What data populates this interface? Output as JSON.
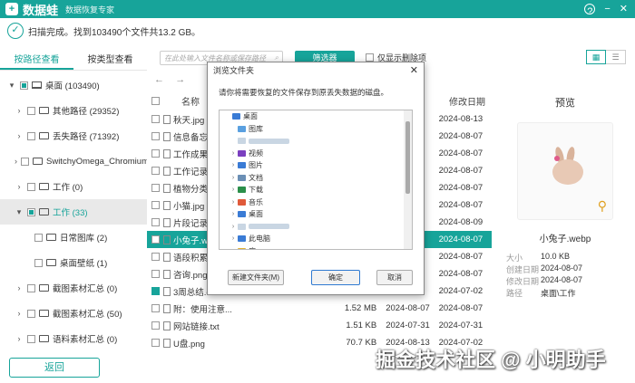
{
  "app": {
    "brand": "数据蛙",
    "subtitle": "数据恢复专家",
    "logo_glyph": "+"
  },
  "window": {
    "help": "?",
    "minimize": "−",
    "close": "✕"
  },
  "status": {
    "text": "扫描完成。找到103490个文件共13.2 GB。"
  },
  "tabs": [
    {
      "label": "按路径查看"
    },
    {
      "label": "按类型查看"
    }
  ],
  "toolbar": {
    "search_placeholder": "在此处输入文件名称或保存路径",
    "filter_label": "筛选器",
    "only_deleted_label": "仅显示删除项"
  },
  "tree": [
    {
      "label": "桌面 (103490)",
      "chev": "▾",
      "check": "partial"
    },
    {
      "label": "其他路径 (29352)",
      "chev": "›",
      "check": "none"
    },
    {
      "label": "丢失路径 (71392)",
      "chev": "›",
      "check": "none"
    },
    {
      "label": "SwitchyOmega_Chromium",
      "chev": "›",
      "check": "none"
    },
    {
      "label": "工作 (0)",
      "chev": "›",
      "check": "none"
    },
    {
      "label": "工作 (33)",
      "chev": "▾",
      "check": "partial"
    },
    {
      "label": "日常图库 (2)",
      "chev": "",
      "check": "none"
    },
    {
      "label": "桌面壁纸 (1)",
      "chev": "",
      "check": "none"
    },
    {
      "label": "截图素材汇总 (0)",
      "chev": "›",
      "check": "none"
    },
    {
      "label": "截图素材汇总 (50)",
      "chev": "›",
      "check": "none"
    },
    {
      "label": "语料素材汇总 (0)",
      "chev": "›",
      "check": "none"
    }
  ],
  "file_table": {
    "headers": {
      "name": "名称",
      "modified": "修改日期"
    },
    "rows": [
      {
        "name": "秋天.jpg",
        "size": "",
        "created": "",
        "modified": "2024-08-13",
        "checked": false
      },
      {
        "name": "信息备忘.t",
        "size": "",
        "created": "",
        "modified": "2024-08-07",
        "checked": false
      },
      {
        "name": "工作成果分",
        "size": "",
        "created": "",
        "modified": "2024-08-07",
        "checked": false
      },
      {
        "name": "工作记录表",
        "size": "",
        "created": "",
        "modified": "2024-08-07",
        "checked": false
      },
      {
        "name": "植物分类.d",
        "size": "",
        "created": "",
        "modified": "2024-08-07",
        "checked": false
      },
      {
        "name": "小猫.jpg",
        "size": "",
        "created": "",
        "modified": "2024-08-07",
        "checked": false
      },
      {
        "name": "片段记录.d",
        "size": "",
        "created": "",
        "modified": "2024-08-09",
        "checked": false
      },
      {
        "name": "小兔子.web",
        "size": "",
        "created": "",
        "modified": "2024-08-07",
        "checked": false
      },
      {
        "name": "语段积累.d",
        "size": "",
        "created": "",
        "modified": "2024-08-07",
        "checked": false
      },
      {
        "name": "咨询.png",
        "size": "",
        "created": "",
        "modified": "2024-08-07",
        "checked": false
      },
      {
        "name": "3周总结.doc",
        "size": "",
        "created": "",
        "modified": "2024-07-02",
        "checked": true
      },
      {
        "name": "附：使用注意...",
        "size": "1.52 MB",
        "created": "2024-08-07",
        "modified": "2024-08-07",
        "checked": false
      },
      {
        "name": "网站链接.txt",
        "size": "1.51 KB",
        "created": "2024-07-31",
        "modified": "2024-07-31",
        "checked": false
      },
      {
        "name": "U盘.png",
        "size": "70.7 KB",
        "created": "2024-08-13",
        "modified": "2024-07-02",
        "checked": false
      }
    ]
  },
  "preview": {
    "title": "预览",
    "file_name": "小兔子.webp",
    "meta": [
      {
        "key": "大小",
        "value": "10.0 KB"
      },
      {
        "key": "创建日期",
        "value": "2024-08-07"
      },
      {
        "key": "修改日期",
        "value": "2024-08-07"
      },
      {
        "key": "路径",
        "value": "桌面\\工作"
      }
    ]
  },
  "nav": {
    "back_arrow": "←",
    "forward_arrow": "→"
  },
  "dialog": {
    "title": "浏览文件夹",
    "message": "请你将需要恢复的文件保存到原丢失数据的磁盘。",
    "tree": [
      {
        "label": "桌面",
        "chev": "",
        "indent": 0,
        "color": "#3a7bd5"
      },
      {
        "label": "图库",
        "chev": "",
        "indent": 1,
        "color": "#5aa0e0"
      },
      {
        "label": "",
        "chev": "",
        "indent": 1,
        "color": "#c9d6e3",
        "blurred": true
      },
      {
        "label": "视频",
        "chev": "›",
        "indent": 1,
        "color": "#7a3fbf"
      },
      {
        "label": "图片",
        "chev": "›",
        "indent": 1,
        "color": "#3a7bd5"
      },
      {
        "label": "文档",
        "chev": "›",
        "indent": 1,
        "color": "#6b8fb5"
      },
      {
        "label": "下载",
        "chev": "›",
        "indent": 1,
        "color": "#2b8f4a"
      },
      {
        "label": "音乐",
        "chev": "›",
        "indent": 1,
        "color": "#e05a3a"
      },
      {
        "label": "桌面",
        "chev": "›",
        "indent": 1,
        "color": "#3a7bd5"
      },
      {
        "label": "",
        "chev": "›",
        "indent": 1,
        "color": "#c9d6e3",
        "blurred": true
      },
      {
        "label": "此电脑",
        "chev": "›",
        "indent": 1,
        "color": "#3a7bd5"
      },
      {
        "label": "库",
        "chev": "›",
        "indent": 1,
        "color": "#e0b030"
      }
    ],
    "new_folder_label": "新建文件夹(M)",
    "ok_label": "确定",
    "cancel_label": "取消"
  },
  "footer": {
    "back_label": "返回"
  },
  "watermark": {
    "text": "掘金技术社区 @ 小明助手"
  },
  "colors": {
    "accent": "#17a49a",
    "selection": "#17a49a"
  }
}
